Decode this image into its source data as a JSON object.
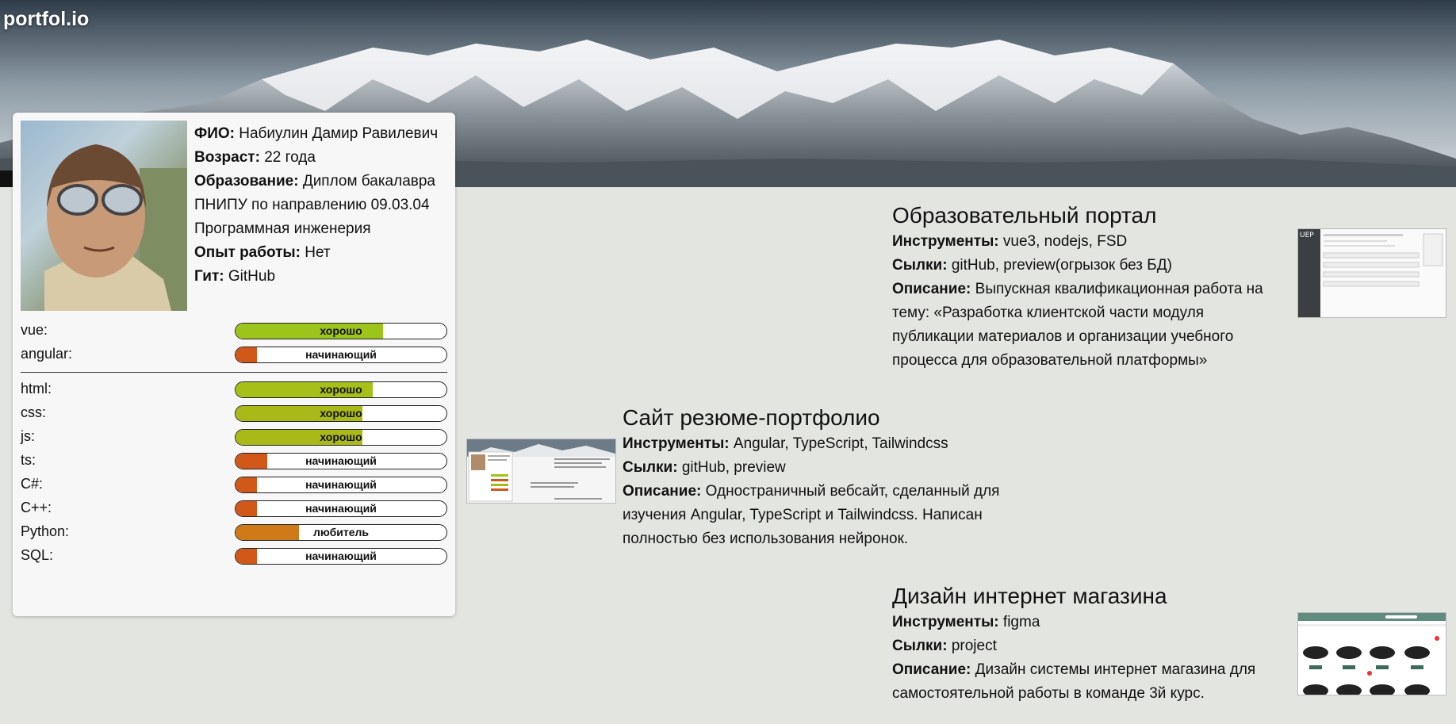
{
  "brand": "portfol.io",
  "profile": {
    "rows": [
      {
        "label": "ФИО:",
        "value": "Набиулин Дамир Равилевич"
      },
      {
        "label": "Возраст:",
        "value": "22 года"
      },
      {
        "label": "Образование:",
        "value": "Диплом бакалавра ПНИПУ по направлению 09.03.04 Программная инженерия"
      },
      {
        "label": "Опыт работы:",
        "value": "Нет"
      },
      {
        "label": "Гит:",
        "value": "GitHub"
      }
    ],
    "frameworks": [
      {
        "name": "vue:",
        "level": "хорошо",
        "percent": 70,
        "color": "#9dc41a"
      },
      {
        "name": "angular:",
        "level": "начинающий",
        "percent": 10,
        "color": "#d2581a"
      }
    ],
    "languages": [
      {
        "name": "html:",
        "level": "хорошо",
        "percent": 65,
        "color": "#a6bf19"
      },
      {
        "name": "css:",
        "level": "хорошо",
        "percent": 60,
        "color": "#a9b918"
      },
      {
        "name": "js:",
        "level": "хорошо",
        "percent": 60,
        "color": "#a9b918"
      },
      {
        "name": "ts:",
        "level": "начинающий",
        "percent": 15,
        "color": "#d2581a"
      },
      {
        "name": "C#:",
        "level": "начинающий",
        "percent": 10,
        "color": "#d2581a"
      },
      {
        "name": "C++:",
        "level": "начинающий",
        "percent": 10,
        "color": "#d2581a"
      },
      {
        "name": "Python:",
        "level": "любитель",
        "percent": 30,
        "color": "#cf7a18"
      },
      {
        "name": "SQL:",
        "level": "начинающий",
        "percent": 10,
        "color": "#d2581a"
      }
    ]
  },
  "projects": [
    {
      "title": "Образовательный портал",
      "tools_label": "Инструменты:",
      "tools": "vue3, nodejs, FSD",
      "links_label": "Сылки:",
      "links": "gitHub, preview(огрызок без БД)",
      "desc_label": "Описание:",
      "desc": "Выпускная квалификационная работа на тему: «Разработка клиентской части модуля публикации материалов и организации учебного процесса для образовательной платформы»"
    },
    {
      "title": "Сайт резюме-портфолио",
      "tools_label": "Инструменты:",
      "tools": "Angular, TypeScript, Tailwindcss",
      "links_label": "Сылки:",
      "links": "gitHub, preview",
      "desc_label": "Описание:",
      "desc": "Одностраничный вебсайт, сделанный для изучения Angular, TypeScript и Tailwindcss. Написан полностью без использования нейронок."
    },
    {
      "title": "Дизайн интернет магазина",
      "tools_label": "Инструменты:",
      "tools": "figma",
      "links_label": "Сылки:",
      "links": "project",
      "desc_label": "Описание:",
      "desc": "Дизайн системы интернет магазина для самостоятельной работы в команде 3й курс."
    }
  ]
}
